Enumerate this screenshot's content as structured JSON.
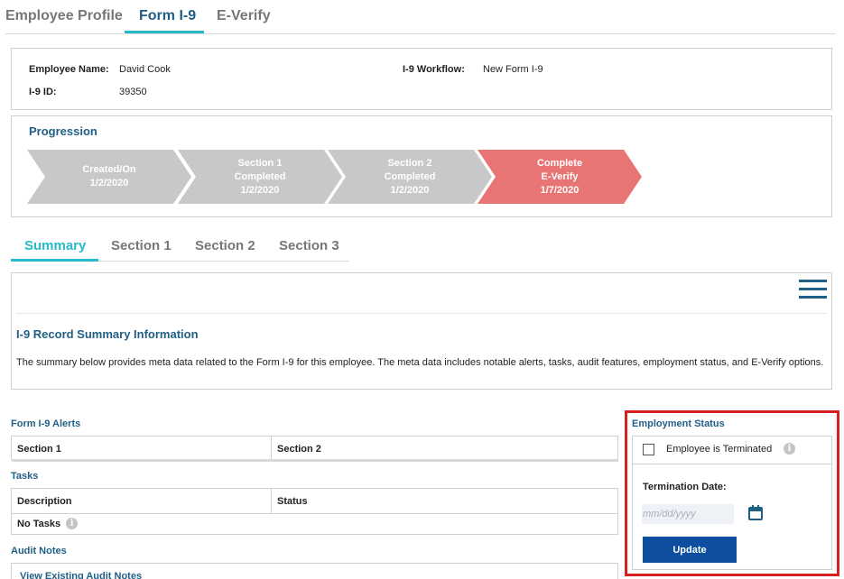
{
  "top_tabs": [
    {
      "label": "Employee Profile"
    },
    {
      "label": "Form I-9"
    },
    {
      "label": "E-Verify"
    }
  ],
  "employee": {
    "name_label": "Employee Name:",
    "name_value": "David Cook",
    "id_label": "I-9 ID:",
    "id_value": "39350",
    "workflow_label": "I-9 Workflow:",
    "workflow_value": "New Form I-9"
  },
  "progression": {
    "title": "Progression",
    "steps": [
      {
        "text": "Created/On\n1/2/2020",
        "state": "done"
      },
      {
        "text": "Section 1\nCompleted\n1/2/2020",
        "state": "done"
      },
      {
        "text": "Section 2\nCompleted\n1/2/2020",
        "state": "done"
      },
      {
        "text": "Complete\nE-Verify\n1/7/2020",
        "state": "current"
      }
    ],
    "colors": {
      "done": "#c8c8c8",
      "current": "#e87474"
    }
  },
  "sub_tabs": [
    {
      "label": "Summary"
    },
    {
      "label": "Section 1"
    },
    {
      "label": "Section 2"
    },
    {
      "label": "Section 3"
    }
  ],
  "summary": {
    "menu_icon": "hamburger-menu-icon",
    "title": "I-9 Record Summary Information",
    "text": "The summary below provides meta data related to the Form I-9 for this employee. The meta data includes notable alerts, tasks, audit features, employment status, and E-Verify options."
  },
  "alerts": {
    "title": "Form I-9 Alerts",
    "columns": [
      "Section 1",
      "Section 2"
    ]
  },
  "tasks": {
    "title": "Tasks",
    "columns": [
      "Description",
      "Status"
    ],
    "empty_text": "No Tasks"
  },
  "audit": {
    "title": "Audit Notes",
    "link": "View Existing Audit Notes"
  },
  "employment_status": {
    "title": "Employment Status",
    "checkbox_label": "Employee is Terminated",
    "date_label": "Termination Date:",
    "date_placeholder": "mm/dd/yyyy",
    "update_label": "Update",
    "highlight_color": "#d62020",
    "button_color": "#0d4f9e"
  }
}
